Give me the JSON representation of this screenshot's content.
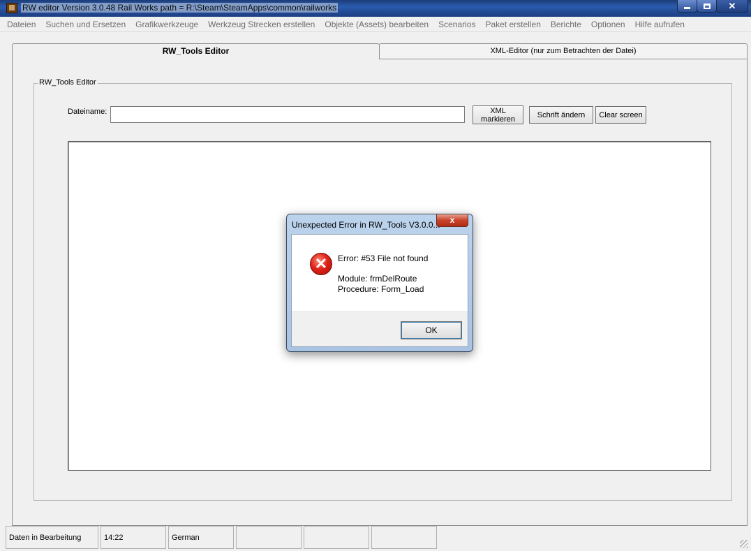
{
  "window": {
    "title": "RW editor  Version 3.0.48   Rail Works path = R:\\Steam\\SteamApps\\common\\railworks"
  },
  "menu": [
    "Dateien",
    "Suchen und Ersetzen",
    "Grafikwerkzeuge",
    "Werkzeug Strecken erstellen",
    "Objekte (Assets) bearbeiten",
    "Scenarios",
    "Paket erstellen",
    "Berichte",
    "Optionen",
    "Hilfe aufrufen"
  ],
  "tabs": {
    "active": "RW_Tools Editor",
    "inactive": "XML-Editor (nur zum Betrachten der Datei)"
  },
  "group": {
    "legend": "RW_Tools Editor",
    "filename_label": "Dateiname:",
    "filename_value": "",
    "xml_button_line1": "XML",
    "xml_button_line2": "markieren",
    "font_button": "Schrift ändern",
    "clear_button": "Clear screen"
  },
  "status": {
    "panels": [
      "Daten in Bearbeitung",
      "14:22",
      "German",
      "",
      "",
      ""
    ]
  },
  "dialog": {
    "title": "Unexpected Error in RW_Tools V3.0.0...",
    "close": "x",
    "error_line": "Error: #53 File not found",
    "module_line": "Module: frmDelRoute",
    "procedure_line": "Procedure: Form_Load",
    "ok": "OK"
  }
}
